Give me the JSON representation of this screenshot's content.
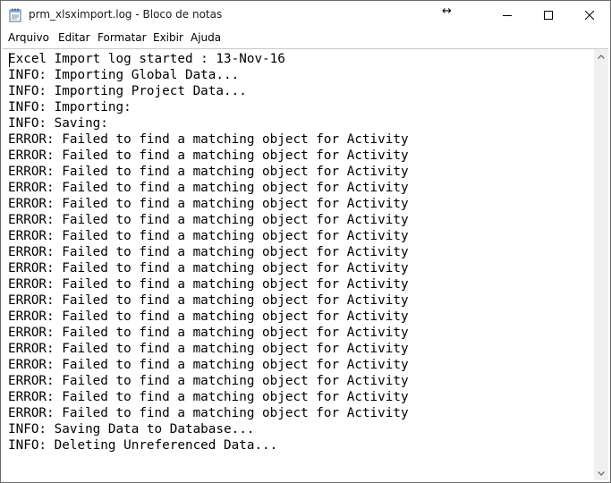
{
  "window": {
    "title": "prm_xlsximport.log - Bloco de notas",
    "resize_cursor_glyph": "↔",
    "icons": {
      "app": "notepad-icon",
      "minimize": "minimize-icon",
      "maximize": "maximize-icon",
      "close": "close-icon"
    }
  },
  "menu": {
    "items": [
      {
        "label": "Arquivo"
      },
      {
        "label": "Editar"
      },
      {
        "label": "Formatar"
      },
      {
        "label": "Exibir"
      },
      {
        "label": "Ajuda"
      }
    ]
  },
  "editor": {
    "lines": [
      "Excel Import log started : 13-Nov-16",
      "INFO: Importing Global Data...",
      "INFO: Importing Project Data...",
      "INFO: Importing:",
      "INFO: Saving:",
      "ERROR: Failed to find a matching object for Activity",
      "ERROR: Failed to find a matching object for Activity",
      "ERROR: Failed to find a matching object for Activity",
      "ERROR: Failed to find a matching object for Activity",
      "ERROR: Failed to find a matching object for Activity",
      "ERROR: Failed to find a matching object for Activity",
      "ERROR: Failed to find a matching object for Activity",
      "ERROR: Failed to find a matching object for Activity",
      "ERROR: Failed to find a matching object for Activity",
      "ERROR: Failed to find a matching object for Activity",
      "ERROR: Failed to find a matching object for Activity",
      "ERROR: Failed to find a matching object for Activity",
      "ERROR: Failed to find a matching object for Activity",
      "ERROR: Failed to find a matching object for Activity",
      "ERROR: Failed to find a matching object for Activity",
      "ERROR: Failed to find a matching object for Activity",
      "ERROR: Failed to find a matching object for Activity",
      "ERROR: Failed to find a matching object for Activity",
      "INFO: Saving Data to Database...",
      "INFO: Deleting Unreferenced Data..."
    ]
  }
}
